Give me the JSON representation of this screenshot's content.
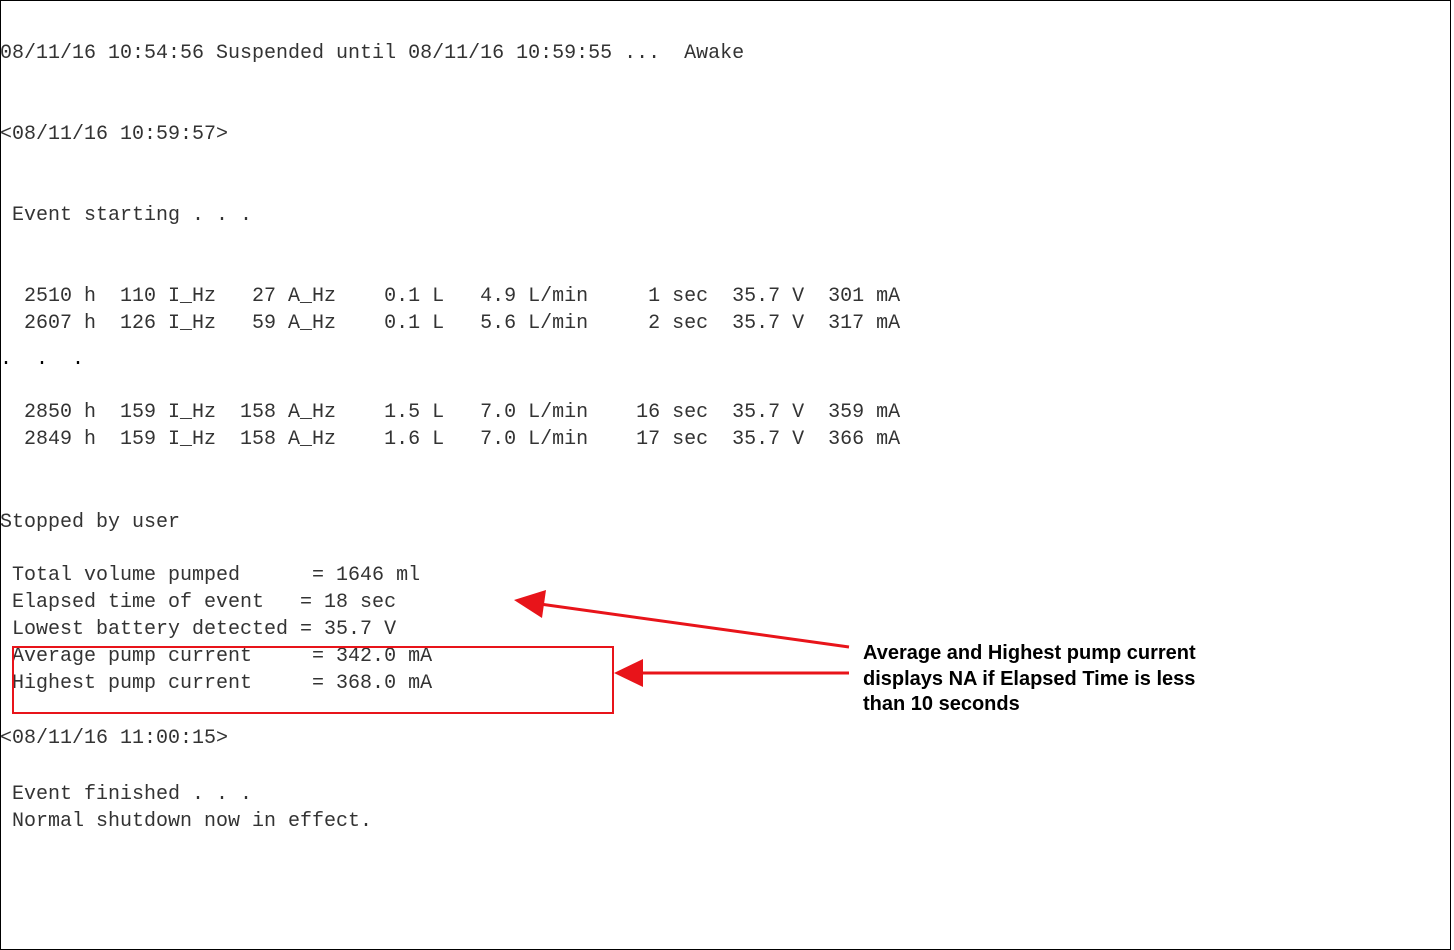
{
  "log": {
    "suspend_line": "08/11/16 10:54:56 Suspended until 08/11/16 10:59:55 ...  Awake",
    "start_timestamp": "<08/11/16 10:59:57>",
    "event_starting": " Event starting . . .",
    "rows_top": [
      "  2510 h  110 I_Hz   27 A_Hz    0.1 L   4.9 L/min     1 sec  35.7 V  301 mA",
      "  2607 h  126 I_Hz   59 A_Hz    0.1 L   5.6 L/min     2 sec  35.7 V  317 mA"
    ],
    "ellipsis": ".  .  .",
    "rows_bottom": [
      "  2850 h  159 I_Hz  158 A_Hz    1.5 L   7.0 L/min    16 sec  35.7 V  359 mA",
      "  2849 h  159 I_Hz  158 A_Hz    1.6 L   7.0 L/min    17 sec  35.7 V  366 mA"
    ],
    "stopped": "Stopped by user",
    "summary": [
      " Total volume pumped      = 1646 ml",
      " Elapsed time of event   = 18 sec",
      " Lowest battery detected = 35.7 V",
      " Average pump current     = 342.0 mA",
      " Highest pump current     = 368.0 mA"
    ],
    "end_timestamp": "<08/11/16 11:00:15>",
    "event_finished": " Event finished . . .",
    "shutdown": " Normal shutdown now in effect."
  },
  "annotation": {
    "lines": [
      "Average and Highest pump current",
      "displays NA if Elapsed Time is less",
      "than 10 seconds"
    ]
  },
  "colors": {
    "annotation_red": "#e8141a",
    "log_text": "#333333",
    "frame": "#000000"
  }
}
